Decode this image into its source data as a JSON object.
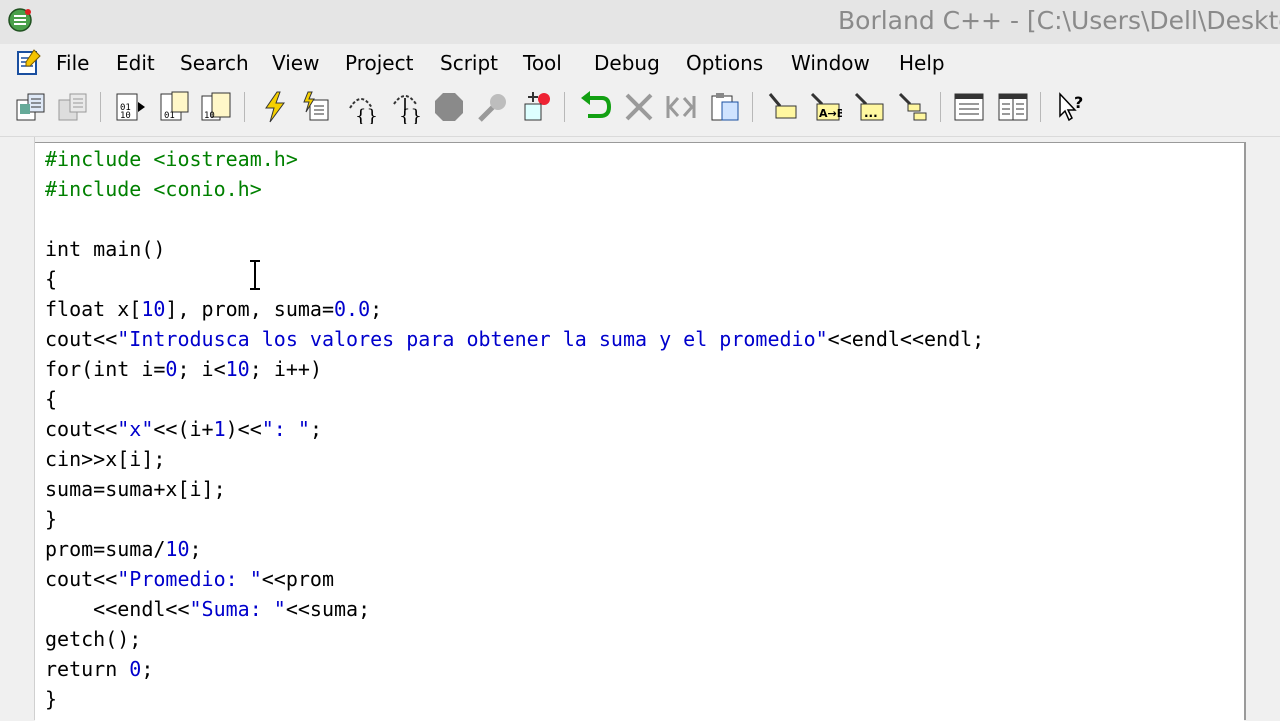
{
  "window": {
    "title": "Borland C++ - [C:\\Users\\Dell\\Deskto"
  },
  "menu": {
    "items": [
      "File",
      "Edit",
      "Search",
      "View",
      "Project",
      "Script",
      "Tool",
      "Debug",
      "Options",
      "Window",
      "Help"
    ]
  },
  "toolbar": {
    "buttons": [
      "open-project-icon",
      "close-project-icon",
      "compile-icon",
      "make-icon",
      "build-icon",
      "run-icon",
      "debug-run-icon",
      "step-over-icon",
      "trace-into-icon",
      "stop-icon",
      "inspect-icon",
      "breakpoint-icon",
      "undo-icon",
      "cut-icon",
      "copy-icon",
      "paste-icon",
      "find-icon",
      "replace-icon",
      "search-again-icon",
      "browse-icon",
      "window-icon",
      "tile-icon",
      "help-icon"
    ]
  },
  "editor": {
    "lines": [
      "#include <iostream.h>",
      "#include <conio.h>",
      "",
      "int main()",
      "{",
      "float x[10], prom, suma=0.0;",
      "cout<<\"Introdusca los valores para obtener la suma y el promedio\"<<endl<<endl;",
      "for(int i=0; i<10; i++)",
      "{",
      "cout<<\"x\"<<(i+1)<<\": \";",
      "cin>>x[i];",
      "suma=suma+x[i];",
      "}",
      "prom=suma/10;",
      "cout<<\"Promedio: \"<<prom",
      "    <<endl<<\"Suma: \"<<suma;",
      "getch();",
      "return 0;",
      "}"
    ]
  },
  "colors": {
    "preprocessor": "#008000",
    "string_literal": "#0000cc",
    "number_literal": "#0000cc",
    "plain_text": "#000000"
  }
}
